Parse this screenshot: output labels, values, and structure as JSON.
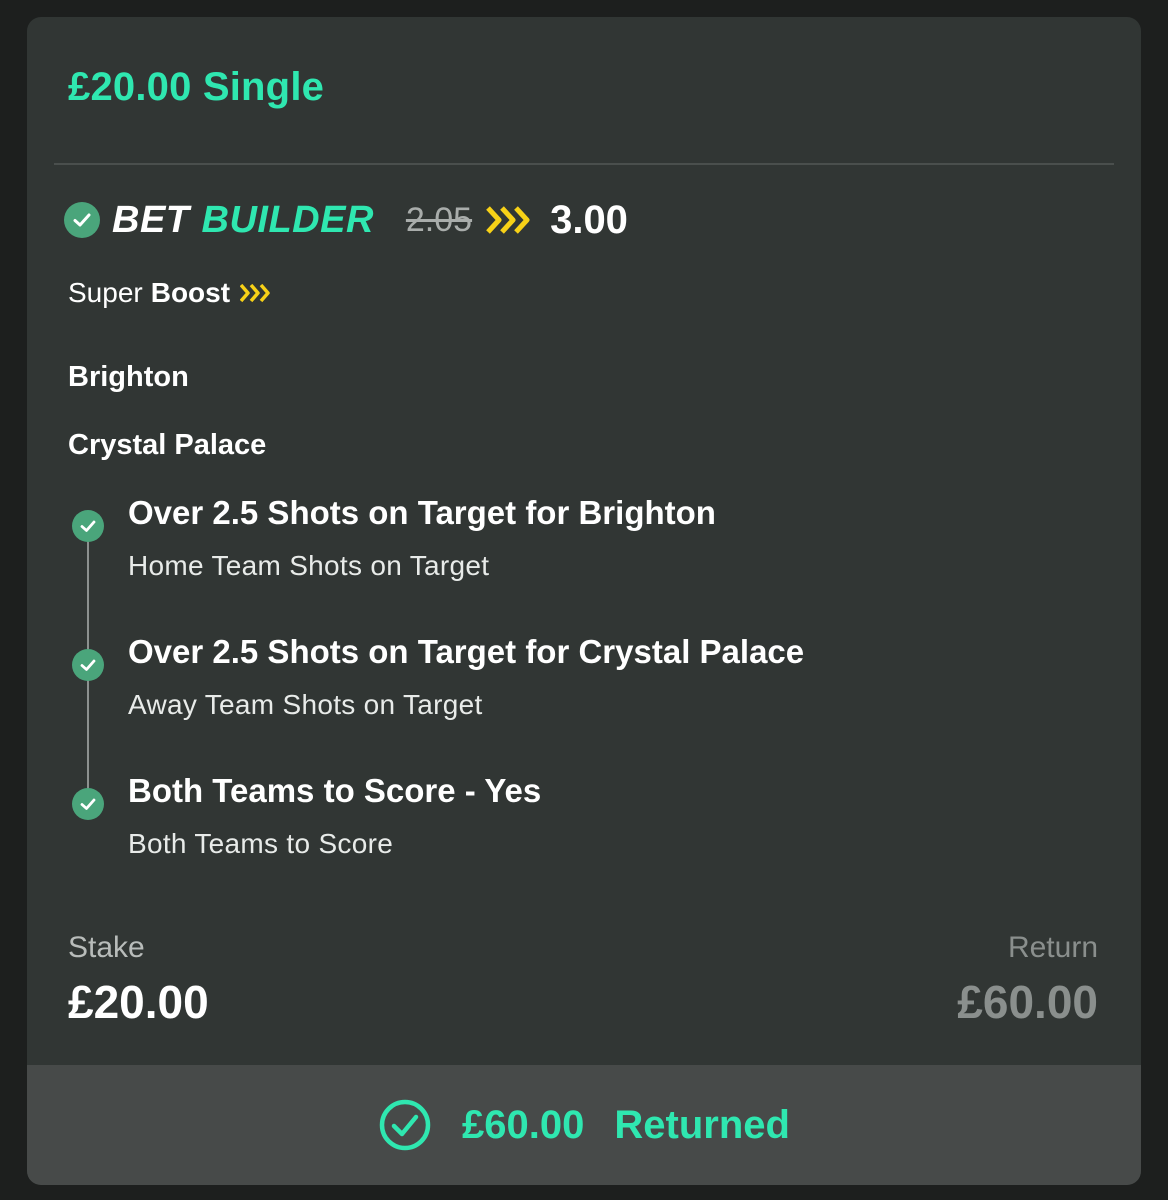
{
  "bet": {
    "header": "£20.00 Single",
    "bet_builder_word1": "BET",
    "bet_builder_word2": "BUILDER",
    "old_odds": "2.05",
    "new_odds": "3.00",
    "super_label": "Super",
    "boost_label": "Boost",
    "teams": [
      "Brighton",
      "Crystal Palace"
    ],
    "legs": [
      {
        "title": "Over 2.5 Shots on Target for Brighton",
        "subtitle": "Home Team Shots on Target"
      },
      {
        "title": "Over 2.5 Shots on Target for Crystal Palace",
        "subtitle": "Away Team Shots on Target"
      },
      {
        "title": "Both Teams to Score - Yes",
        "subtitle": "Both Teams to Score"
      }
    ],
    "stake_label": "Stake",
    "stake_value": "£20.00",
    "return_label": "Return",
    "return_value": "£60.00",
    "returned_amount": "£60.00",
    "returned_label": "Returned"
  },
  "colors": {
    "accent": "#2fe7b0",
    "check_green": "#4aa57b",
    "boost_yellow": "#f7d117",
    "card_bg": "#313634",
    "footer_bg": "#474a49"
  },
  "icons": {
    "leg_status": "check-circle-icon",
    "boost": "chevron-arrows-icon",
    "returned": "check-circle-outline-icon"
  }
}
